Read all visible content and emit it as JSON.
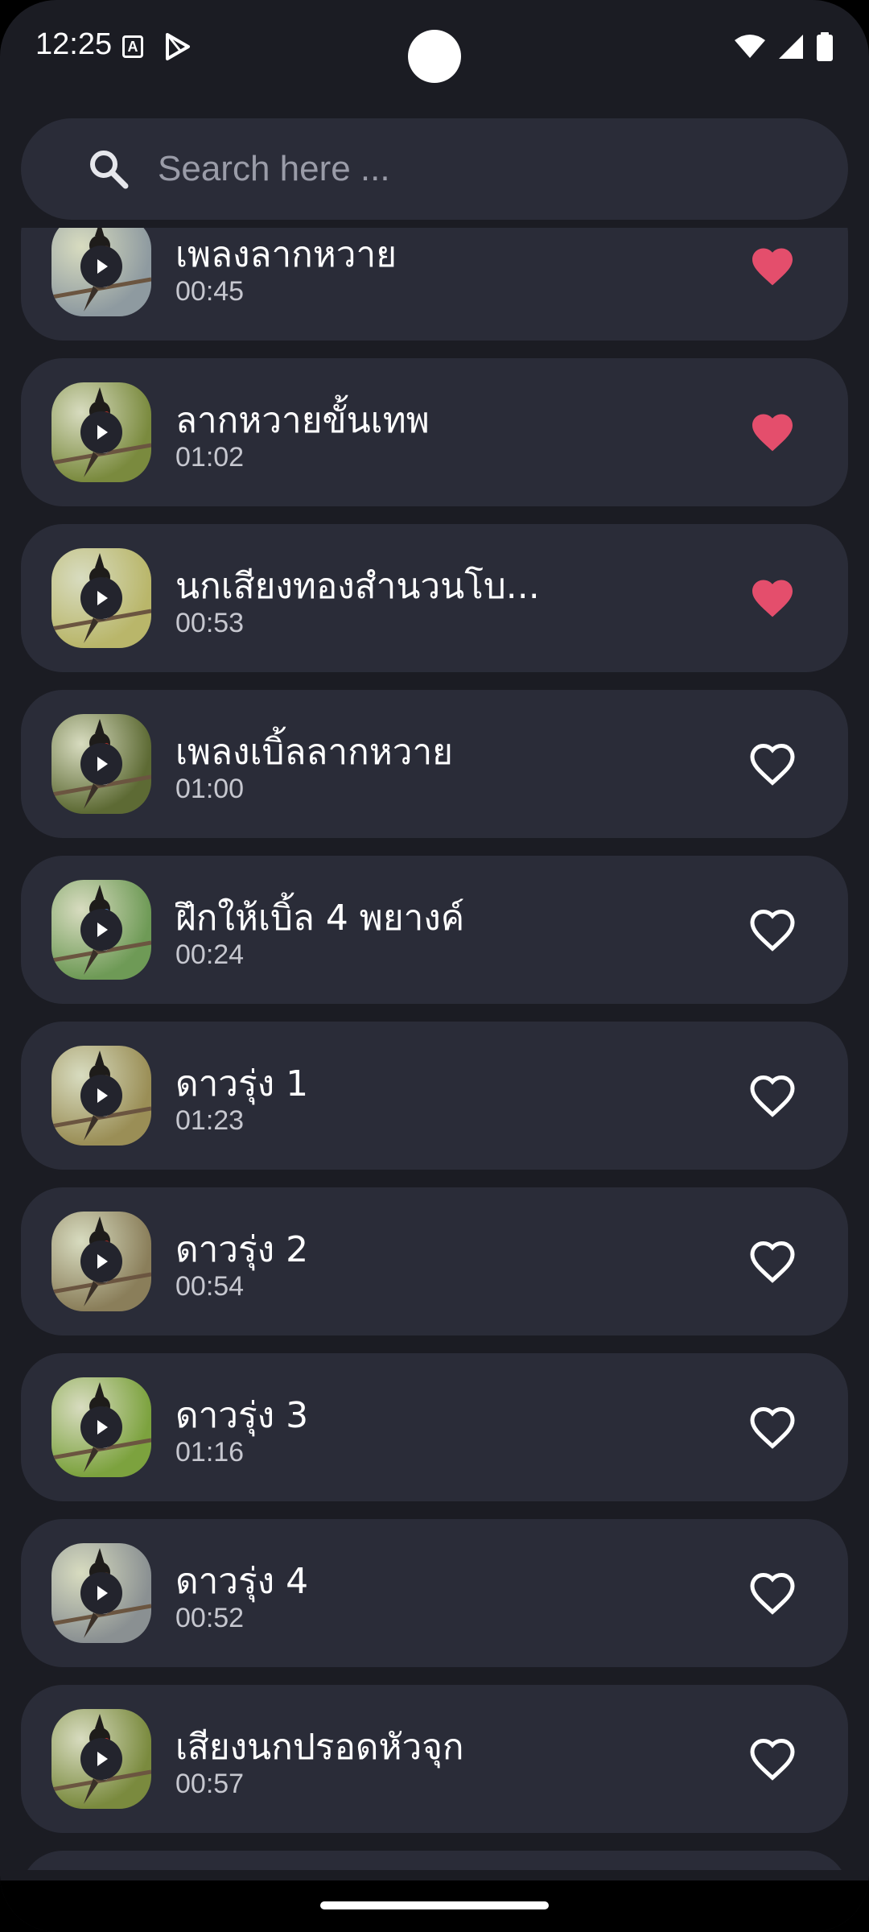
{
  "status_bar": {
    "time": "12:25",
    "app_icon_letter": "A"
  },
  "search": {
    "placeholder": "Search here ..."
  },
  "colors": {
    "background": "#1b1c23",
    "card": "#2a2c38",
    "heart_favorite": "#e44e6c",
    "heart_outline": "#ffffff"
  },
  "songs": [
    {
      "title": "เพลงลากหวาย",
      "duration": "00:45",
      "favorite": true,
      "thumb_bg": "#8e9aa0",
      "bird_accent": "#3a2a22"
    },
    {
      "title": "ลากหวายขั้นเทพ",
      "duration": "01:02",
      "favorite": true,
      "thumb_bg": "#7a8a3e",
      "bird_accent": "#c03028"
    },
    {
      "title": "นกเสียงทองสำนวนโบ...",
      "duration": "00:53",
      "favorite": true,
      "thumb_bg": "#b9b66a",
      "bird_accent": "#2c2a24"
    },
    {
      "title": "เพลงเบิ้ลลากหวาย",
      "duration": "01:00",
      "favorite": false,
      "thumb_bg": "#5d6a34",
      "bird_accent": "#c03028"
    },
    {
      "title": "ฝึกให้เบิ้ล 4 พยางค์",
      "duration": "00:24",
      "favorite": false,
      "thumb_bg": "#6e9a56",
      "bird_accent": "#4a78b8"
    },
    {
      "title": "ดาวรุ่ง 1",
      "duration": "01:23",
      "favorite": false,
      "thumb_bg": "#9a8e56",
      "bird_accent": "#3a3024"
    },
    {
      "title": "ดาวรุ่ง 2",
      "duration": "00:54",
      "favorite": false,
      "thumb_bg": "#8a7e5a",
      "bird_accent": "#b42a24"
    },
    {
      "title": "ดาวรุ่ง 3",
      "duration": "01:16",
      "favorite": false,
      "thumb_bg": "#7ca23e",
      "bird_accent": "#2c2a24"
    },
    {
      "title": "ดาวรุ่ง 4",
      "duration": "00:52",
      "favorite": false,
      "thumb_bg": "#8a9092",
      "bird_accent": "#3a2a22"
    },
    {
      "title": "เสียงนกปรอดหัวจุก",
      "duration": "00:57",
      "favorite": false,
      "thumb_bg": "#7a8a3e",
      "bird_accent": "#c03028"
    },
    {
      "title": "",
      "duration": "",
      "favorite": false,
      "thumb_bg": "#7a8a3e",
      "bird_accent": "#3a2a22"
    }
  ]
}
